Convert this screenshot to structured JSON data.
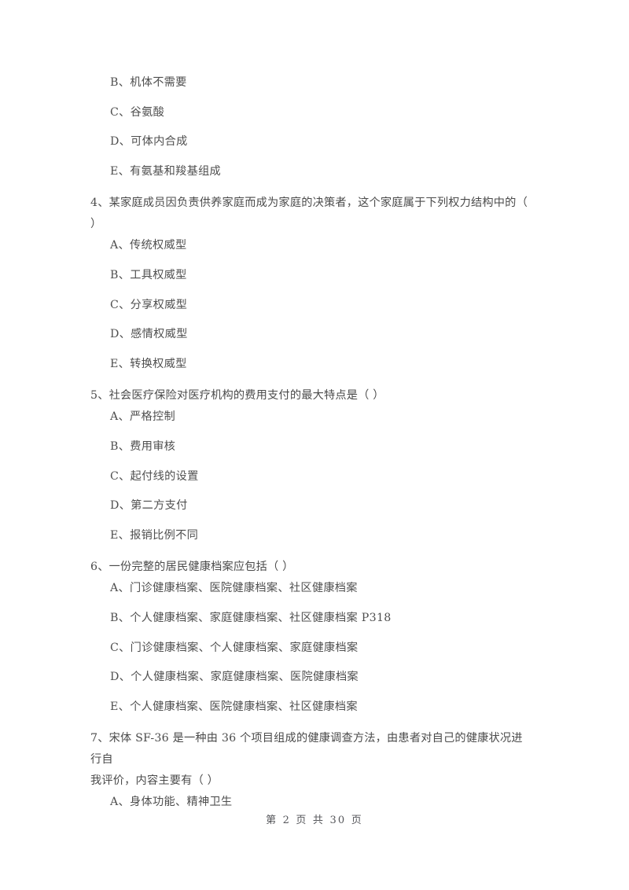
{
  "document": {
    "page_footer": "第 2 页  共 30 页",
    "page_number": "2",
    "total_pages": "30",
    "text_color": "#4d4d4d",
    "background_color": "#ffffff"
  },
  "content_blocks": [
    {
      "type": "orphan_options",
      "options": [
        "B、机体不需要",
        "C、谷氨酸",
        "D、可体内合成",
        "E、有氨基和羧基组成"
      ]
    },
    {
      "type": "question",
      "stem_line_1": "4、某家庭成员因负责供养家庭而成为家庭的决策者，这个家庭属于下列权力结构中的（",
      "stem_line_2": "）",
      "options": [
        "A、传统权威型",
        "B、工具权威型",
        "C、分享权威型",
        "D、感情权威型",
        "E、转换权威型"
      ]
    },
    {
      "type": "question",
      "stem_line_1": "5、社会医疗保险对医疗机构的费用支付的最大特点是（    ）",
      "stem_line_2": "",
      "options": [
        "A、严格控制",
        "B、费用审核",
        "C、起付线的设置",
        "D、第二方支付",
        "E、报销比例不同"
      ]
    },
    {
      "type": "question",
      "stem_line_1": "6、一份完整的居民健康档案应包括（    ）",
      "stem_line_2": "",
      "options": [
        "A、门诊健康档案、医院健康档案、社区健康档案",
        "B、个人健康档案、家庭健康档案、社区健康档案 P318",
        "C、门诊健康档案、个人健康档案、家庭健康档案",
        "D、个人健康档案、家庭健康档案、医院健康档案",
        "E、个人健康档案、医院健康档案、社区健康档案"
      ]
    },
    {
      "type": "question",
      "stem_line_1": "7、宋体 SF-36 是一种由 36 个项目组成的健康调查方法，由患者对自己的健康状况进行自",
      "stem_line_2": "我评价，内容主要有（    ）",
      "options": [
        "A、身体功能、精神卫生"
      ]
    }
  ]
}
